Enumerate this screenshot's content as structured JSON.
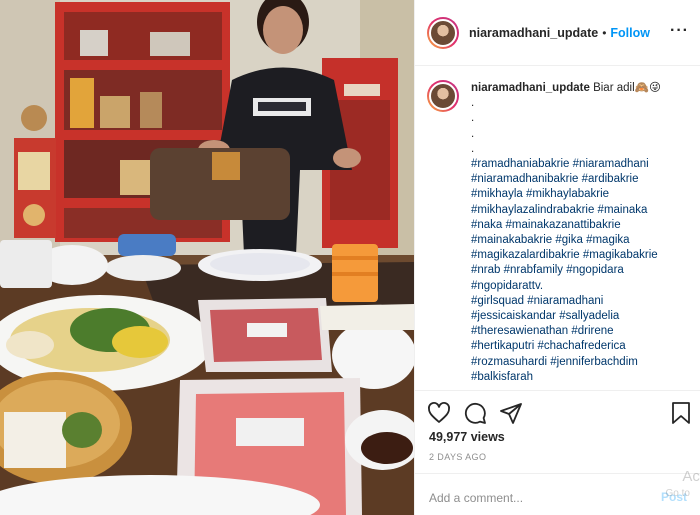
{
  "post": {
    "username": "niaramadhani_update",
    "separator": "•",
    "follow_label": "Follow",
    "more_icon": "more-options-icon",
    "more_label": "···"
  },
  "caption": {
    "username": "niaramadhani_update",
    "text": "Biar adil🙈😜",
    "dots": [
      ".",
      ".",
      ".",
      "."
    ],
    "hashtags": [
      "#ramadhaniabakrie #niaramadhani",
      "#niaramadhanibakrie #ardibakrie",
      "#mikhayla #mikhaylabakrie",
      "#mikhaylazalindrabakrie #mainaka",
      "#naka #mainakazanattibakrie",
      "#mainakabakrie #gika #magika",
      "#magikazalardibakrie #magikabakrie",
      "#nrab #nrabfamily #ngopidara",
      "#ngopidarattv.",
      "#girlsquad #niaramadhani",
      "#jessicaiskandar #sallyadelia",
      "#theresawienathan #drirene",
      "#hertikaputri #chachafrederica",
      "#rozmasuhardi #jenniferbachdim",
      "#balkisfarah"
    ]
  },
  "actions": {
    "like_icon": "heart-icon",
    "comment_icon": "comment-icon",
    "share_icon": "share-icon",
    "save_icon": "bookmark-icon"
  },
  "stats": {
    "views": "49,977 views",
    "date": "2 DAYS AGO"
  },
  "comment": {
    "placeholder": "Add a comment...",
    "post_label": "Post"
  },
  "watermark": {
    "line1": "Act",
    "line2": "Go to"
  },
  "colors": {
    "link": "#0095f6",
    "hashtag": "#00376b",
    "muted": "#8e8e8e",
    "border": "#efefef"
  }
}
